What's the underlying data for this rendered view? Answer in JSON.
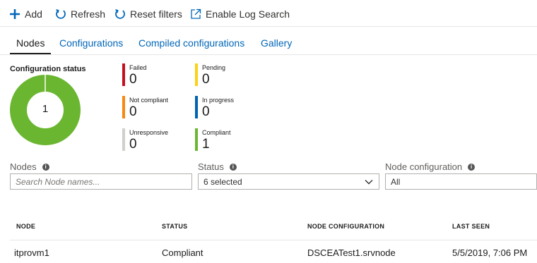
{
  "toolbar": {
    "add_label": "Add",
    "refresh_label": "Refresh",
    "reset_label": "Reset filters",
    "log_label": "Enable Log Search"
  },
  "tabs": [
    {
      "label": "Nodes",
      "active": true
    },
    {
      "label": "Configurations",
      "active": false
    },
    {
      "label": "Compiled configurations",
      "active": false
    },
    {
      "label": "Gallery",
      "active": false
    }
  ],
  "status": {
    "title": "Configuration status",
    "total": "1",
    "donut_color": "#6bb631",
    "items": [
      {
        "label": "Failed",
        "value": "0",
        "color": "#c50f1f"
      },
      {
        "label": "Pending",
        "value": "0",
        "color": "#fcd116"
      },
      {
        "label": "Not compliant",
        "value": "0",
        "color": "#f7890f"
      },
      {
        "label": "In progress",
        "value": "0",
        "color": "#0063b1"
      },
      {
        "label": "Unresponsive",
        "value": "0",
        "color": "#d2d0ce"
      },
      {
        "label": "Compliant",
        "value": "1",
        "color": "#6bb631"
      }
    ]
  },
  "filters": {
    "nodes_label": "Nodes",
    "nodes_placeholder": "Search Node names...",
    "status_label": "Status",
    "status_value": "6 selected",
    "config_label": "Node configuration",
    "config_value": "All"
  },
  "table": {
    "headers": [
      "NODE",
      "STATUS",
      "NODE CONFIGURATION",
      "LAST SEEN"
    ],
    "rows": [
      [
        "itprovm1",
        "Compliant",
        "DSCEATest1.srvnode",
        "5/5/2019, 7:06 PM"
      ]
    ]
  }
}
